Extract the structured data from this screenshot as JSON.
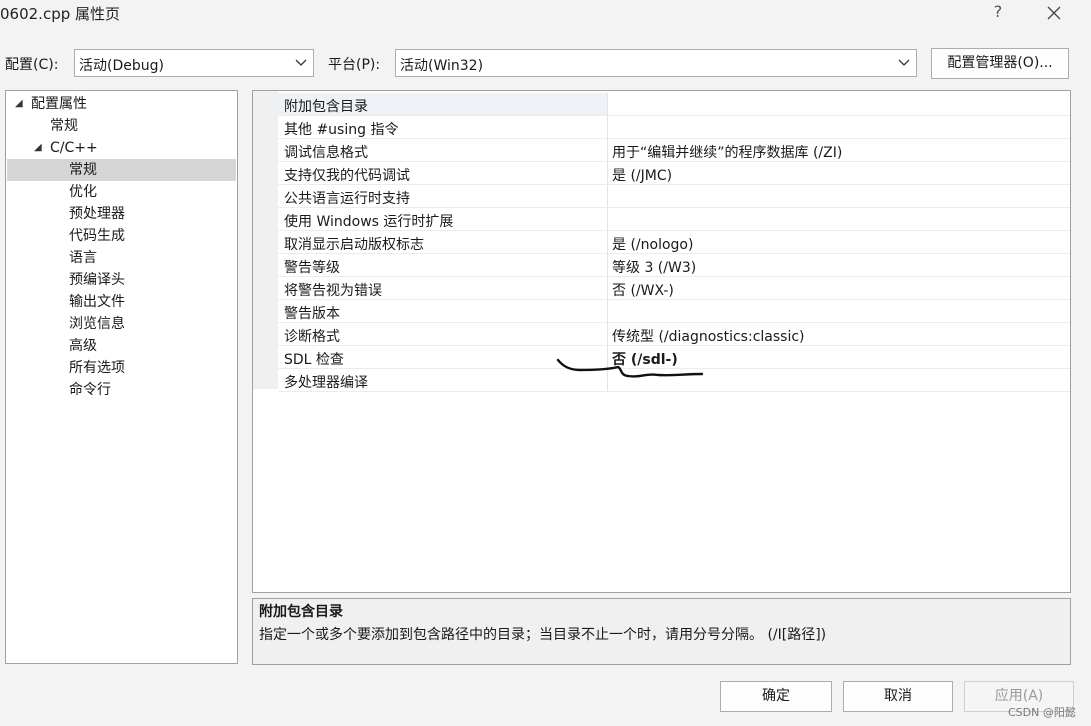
{
  "window": {
    "title": "0602.cpp 属性页",
    "help_label": "?",
    "close_icon": "close-icon"
  },
  "toolbar": {
    "config_label": "配置(C):",
    "config_value": "活动(Debug)",
    "platform_label": "平台(P):",
    "platform_value": "活动(Win32)",
    "manager_label": "配置管理器(O)..."
  },
  "tree": {
    "items": [
      {
        "label": "配置属性",
        "expanded": true
      },
      {
        "label": "常规"
      },
      {
        "label": "C/C++",
        "expanded": true
      },
      {
        "label": "常规",
        "selected": true
      },
      {
        "label": "优化"
      },
      {
        "label": "预处理器"
      },
      {
        "label": "代码生成"
      },
      {
        "label": "语言"
      },
      {
        "label": "预编译头"
      },
      {
        "label": "输出文件"
      },
      {
        "label": "浏览信息"
      },
      {
        "label": "高级"
      },
      {
        "label": "所有选项"
      },
      {
        "label": "命令行"
      }
    ]
  },
  "grid": {
    "rows": [
      {
        "name": "附加包含目录",
        "value": ""
      },
      {
        "name": "其他 #using 指令",
        "value": ""
      },
      {
        "name": "调试信息格式",
        "value": "用于“编辑并继续”的程序数据库 (/ZI)"
      },
      {
        "name": "支持仅我的代码调试",
        "value": "是 (/JMC)"
      },
      {
        "name": "公共语言运行时支持",
        "value": ""
      },
      {
        "name": "使用 Windows 运行时扩展",
        "value": ""
      },
      {
        "name": "取消显示启动版权标志",
        "value": "是 (/nologo)"
      },
      {
        "name": "警告等级",
        "value": "等级 3 (/W3)"
      },
      {
        "name": "将警告视为错误",
        "value": "否 (/WX-)"
      },
      {
        "name": "警告版本",
        "value": ""
      },
      {
        "name": "诊断格式",
        "value": "传统型 (/diagnostics:classic)"
      },
      {
        "name": "SDL 检查",
        "value": "否 (/sdl-)",
        "bold": true
      },
      {
        "name": "多处理器编译",
        "value": ""
      }
    ]
  },
  "description": {
    "title": "附加包含目录",
    "body": "指定一个或多个要添加到包含路径中的目录；当目录不止一个时，请用分号分隔。     (/I[路径])"
  },
  "buttons": {
    "ok": "确定",
    "cancel": "取消",
    "apply": "应用(A)"
  },
  "watermark": "CSDN @阳懿",
  "colors": {
    "window_bg": "#f3f3f3",
    "selection_bg": "#d6d6d6",
    "annotation_stroke": "#111111"
  }
}
